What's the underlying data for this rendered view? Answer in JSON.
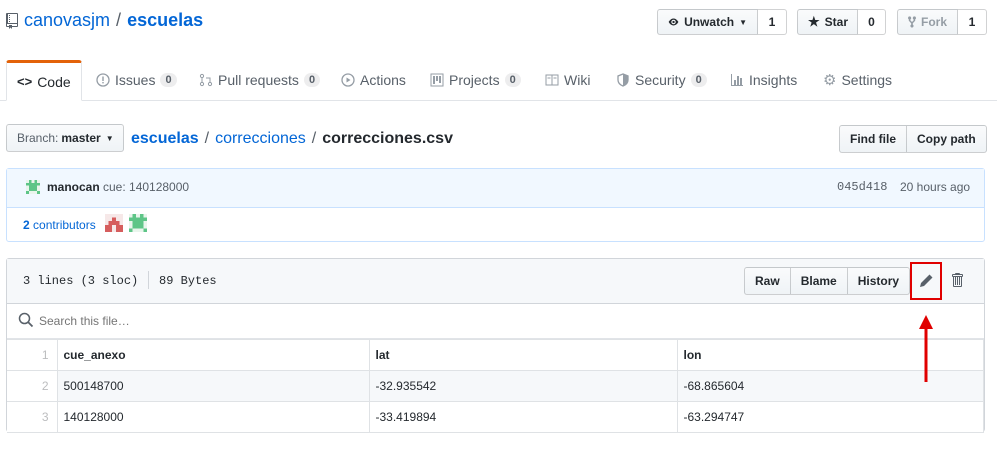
{
  "repo": {
    "owner": "canovasjm",
    "separator": "/",
    "name": "escuelas"
  },
  "actions": {
    "watch": {
      "label": "Unwatch",
      "count": "1"
    },
    "star": {
      "label": "Star",
      "count": "0"
    },
    "fork": {
      "label": "Fork",
      "count": "1"
    }
  },
  "tabs": [
    {
      "label": "Code",
      "icon": "code-icon"
    },
    {
      "label": "Issues",
      "badge": "0",
      "icon": "issue-icon"
    },
    {
      "label": "Pull requests",
      "badge": "0",
      "icon": "pull-request-icon"
    },
    {
      "label": "Actions",
      "icon": "play-icon"
    },
    {
      "label": "Projects",
      "badge": "0",
      "icon": "project-icon"
    },
    {
      "label": "Wiki",
      "icon": "book-icon"
    },
    {
      "label": "Security",
      "badge": "0",
      "icon": "shield-icon"
    },
    {
      "label": "Insights",
      "icon": "graph-icon"
    },
    {
      "label": "Settings",
      "icon": "gear-icon"
    }
  ],
  "branch": {
    "prefix": "Branch:",
    "name": "master"
  },
  "breadcrumb": {
    "repo": "escuelas",
    "dir": "correcciones",
    "file": "correcciones.csv",
    "sep": "/"
  },
  "file_actions": {
    "find": "Find file",
    "copy": "Copy path"
  },
  "commit": {
    "author": "manocan",
    "message": "cue: 140128000",
    "sha": "045d418",
    "time": "20 hours ago",
    "contributors_count": "2",
    "contributors_label": "contributors"
  },
  "file_info": {
    "lines": "3 lines (3 sloc)",
    "size": "89 Bytes"
  },
  "file_buttons": {
    "raw": "Raw",
    "blame": "Blame",
    "history": "History"
  },
  "search": {
    "placeholder": "Search this file…"
  },
  "csv": {
    "headers": [
      "cue_anexo",
      "lat",
      "lon"
    ],
    "rows": [
      {
        "line": "2",
        "cells": [
          "500148700",
          "-32.935542",
          "-68.865604"
        ]
      },
      {
        "line": "3",
        "cells": [
          "140128000",
          "-33.419894",
          "-63.294747"
        ]
      }
    ],
    "header_line": "1"
  },
  "colors": {
    "link": "#0366d6",
    "tab_accent": "#e36209",
    "annotation": "#e00000"
  }
}
